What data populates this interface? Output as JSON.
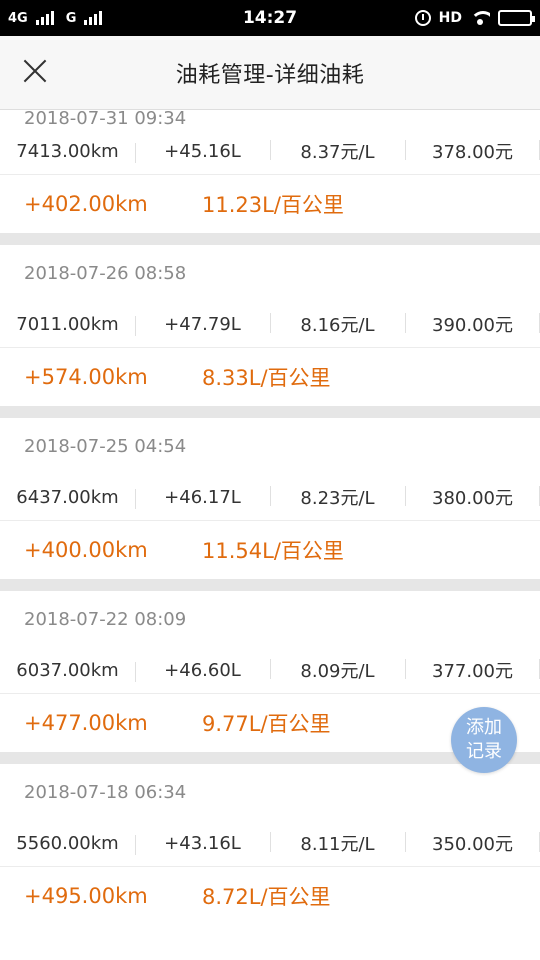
{
  "status_bar": {
    "network1": "4G",
    "network2": "G",
    "time": "14:27",
    "hd": "HD",
    "battery_level": 0.95
  },
  "header": {
    "title": "油耗管理-详细油耗"
  },
  "records": [
    {
      "date": "2018-07-31 09:34",
      "odometer": "7413.00km",
      "fuel": "+45.16L",
      "price": "8.37元/L",
      "cost": "378.00元",
      "distance": "+402.00km",
      "consumption": "11.23L/百公里"
    },
    {
      "date": "2018-07-26 08:58",
      "odometer": "7011.00km",
      "fuel": "+47.79L",
      "price": "8.16元/L",
      "cost": "390.00元",
      "distance": "+574.00km",
      "consumption": "8.33L/百公里"
    },
    {
      "date": "2018-07-25 04:54",
      "odometer": "6437.00km",
      "fuel": "+46.17L",
      "price": "8.23元/L",
      "cost": "380.00元",
      "distance": "+400.00km",
      "consumption": "11.54L/百公里"
    },
    {
      "date": "2018-07-22 08:09",
      "odometer": "6037.00km",
      "fuel": "+46.60L",
      "price": "8.09元/L",
      "cost": "377.00元",
      "distance": "+477.00km",
      "consumption": "9.77L/百公里"
    },
    {
      "date": "2018-07-18 06:34",
      "odometer": "5560.00km",
      "fuel": "+43.16L",
      "price": "8.11元/L",
      "cost": "350.00元",
      "distance": "+495.00km",
      "consumption": "8.72L/百公里"
    }
  ],
  "fab": {
    "line1": "添加",
    "line2": "记录"
  },
  "colors": {
    "accent": "#e06b0e",
    "fab": "#8fb4e2",
    "divider": "#e6e6e6"
  }
}
